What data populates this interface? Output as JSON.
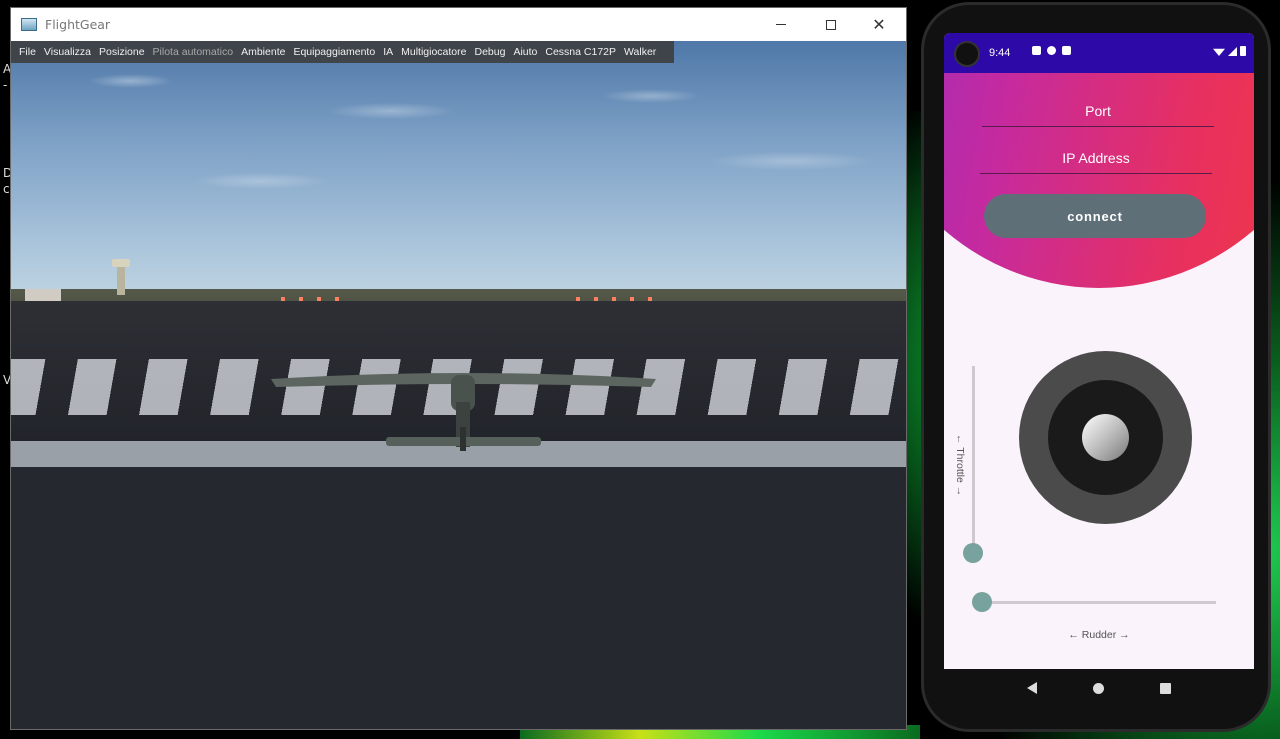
{
  "desktop": {
    "letters": [
      "A",
      "-",
      "D",
      "c",
      "V"
    ]
  },
  "flightgear": {
    "title": "FlightGear",
    "menu": [
      {
        "label": "File",
        "enabled": true
      },
      {
        "label": "Visualizza",
        "enabled": true
      },
      {
        "label": "Posizione",
        "enabled": true
      },
      {
        "label": "Pilota automatico",
        "enabled": false
      },
      {
        "label": "Ambiente",
        "enabled": true
      },
      {
        "label": "Equipaggiamento",
        "enabled": true
      },
      {
        "label": "IA",
        "enabled": true
      },
      {
        "label": "Multigiocatore",
        "enabled": true
      },
      {
        "label": "Debug",
        "enabled": true
      },
      {
        "label": "Aiuto",
        "enabled": true
      },
      {
        "label": "Cessna C172P",
        "enabled": true
      },
      {
        "label": "Walker",
        "enabled": true
      }
    ]
  },
  "phone": {
    "status": {
      "time": "9:44"
    },
    "form": {
      "port_placeholder": "Port",
      "ip_placeholder": "IP Address",
      "connect_label": "connect"
    },
    "controls": {
      "throttle_label": "← Throttle →",
      "rudder_label": "← Rudder →",
      "throttle_value": 0,
      "rudder_value": 0
    },
    "colors": {
      "accent": "#78a29d",
      "button": "#5f6f78",
      "status_bar": "#2d0aa8"
    }
  }
}
